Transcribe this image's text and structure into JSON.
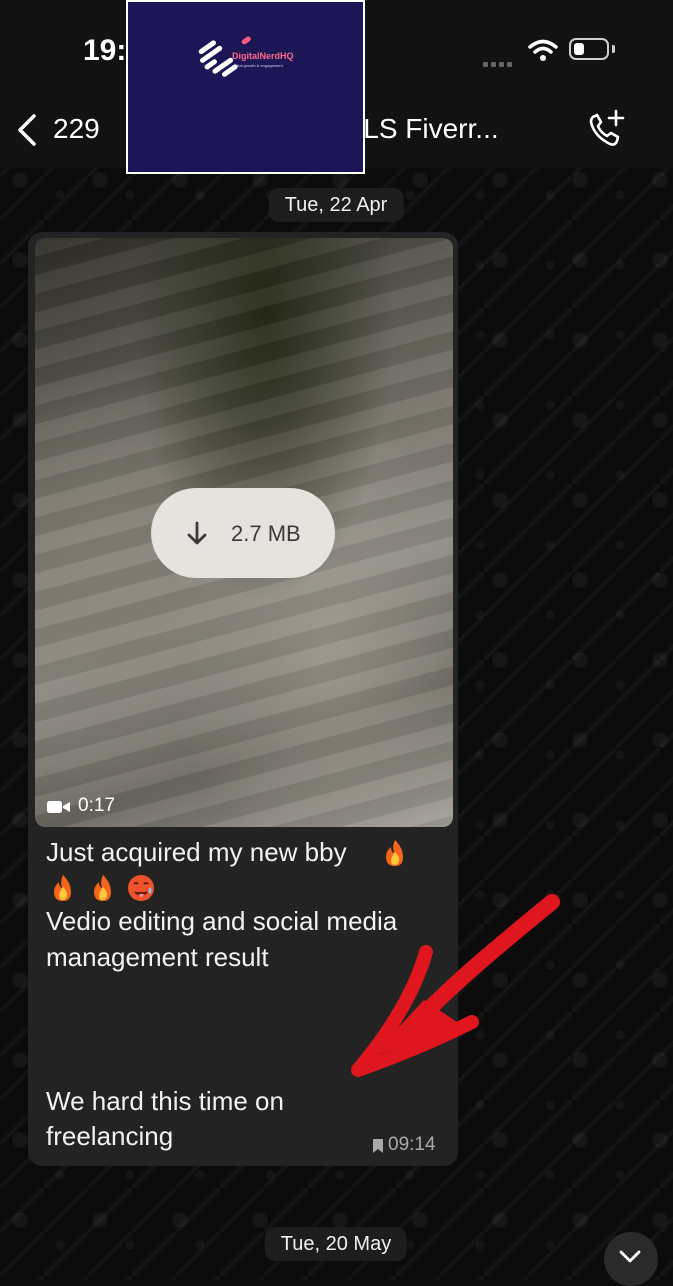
{
  "status_bar": {
    "time": "19:"
  },
  "header": {
    "back_count": "229",
    "title": "GITALS Fiverr..."
  },
  "overlay_logo": {
    "name": "DigitalNerdHQ",
    "tagline": "digital growth & engagement"
  },
  "dates": [
    "Tue, 22 Apr",
    "Tue, 20 May"
  ],
  "message": {
    "video": {
      "size": "2.7 MB",
      "duration": "0:17"
    },
    "lines": [
      "Just acquired my new bby",
      "Vedio editing and social media",
      "management result",
      "We hard this time on",
      "freelancing"
    ],
    "emojis": [
      "fire",
      "fire",
      "fire",
      "hot-face"
    ],
    "time": "09:14"
  },
  "colors": {
    "background": "#0b0b0b",
    "bubble": "#232323",
    "logo_bg": "#1d1656",
    "annotation_arrow": "#e0161f"
  }
}
